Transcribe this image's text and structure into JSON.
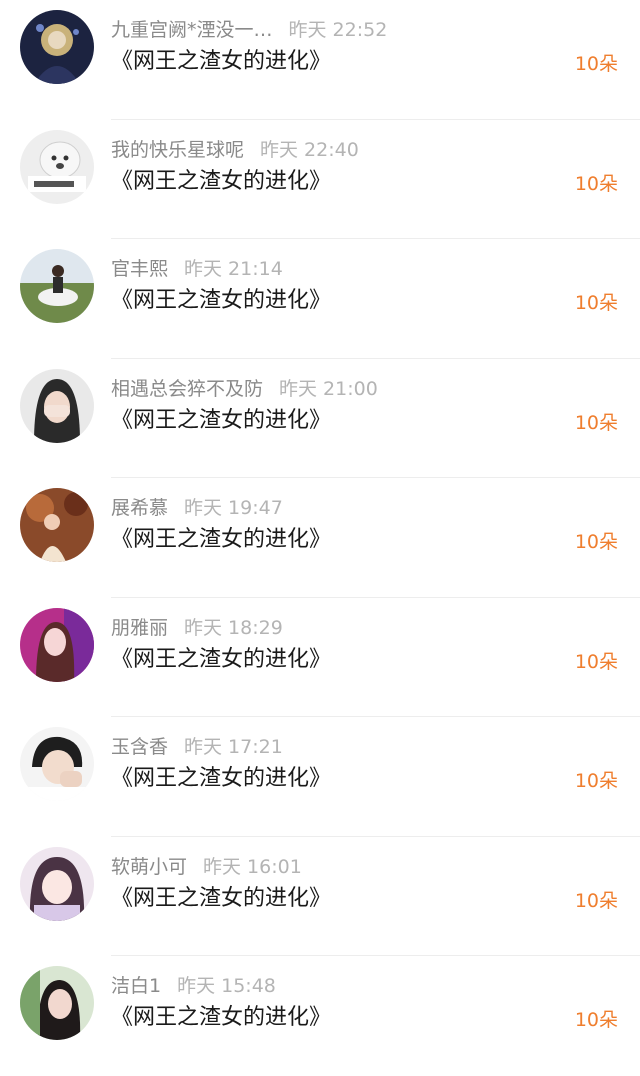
{
  "book_title": "《网王之渣女的进化》",
  "amount_label": "10朵",
  "items": [
    {
      "name": "九重宫阙*湮没一…",
      "time": "昨天 22:52",
      "avatar": "avatar-dark-doll"
    },
    {
      "name": "我的快乐星球呢",
      "time": "昨天 22:40",
      "avatar": "avatar-dog-meme"
    },
    {
      "name": "官丰熙",
      "time": "昨天 21:14",
      "avatar": "avatar-horse-rider"
    },
    {
      "name": "相遇总会猝不及防",
      "time": "昨天 21:00",
      "avatar": "avatar-girl-covering-face"
    },
    {
      "name": "展希慕",
      "time": "昨天 19:47",
      "avatar": "avatar-girl-autumn"
    },
    {
      "name": "朋雅丽",
      "time": "昨天 18:29",
      "avatar": "avatar-girl-pink"
    },
    {
      "name": "玉含香",
      "time": "昨天 17:21",
      "avatar": "avatar-boy-hand"
    },
    {
      "name": "软萌小可",
      "time": "昨天 16:01",
      "avatar": "avatar-anime-girl"
    },
    {
      "name": "洁白1",
      "time": "昨天 15:48",
      "avatar": "avatar-girl-longhair"
    }
  ]
}
